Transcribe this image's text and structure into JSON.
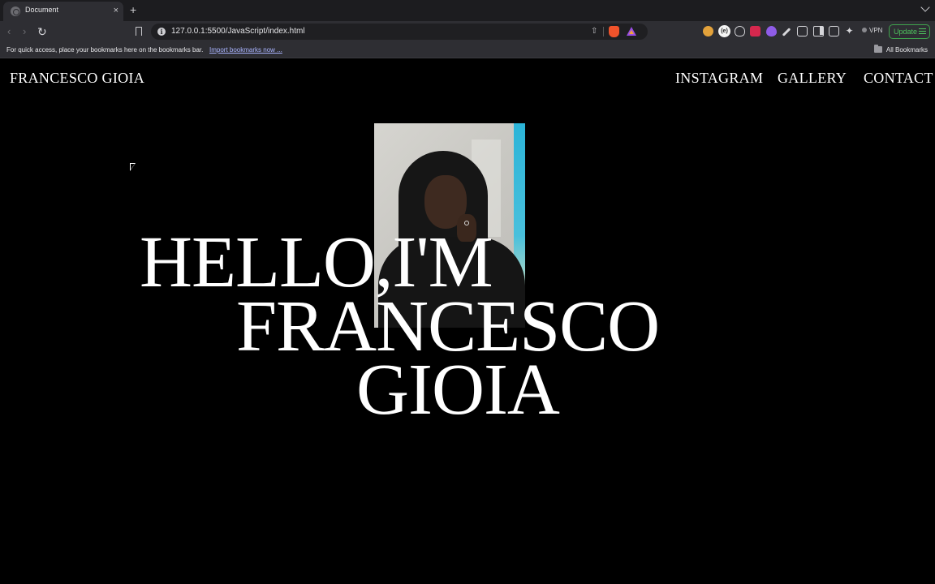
{
  "browser": {
    "tab_title": "Document",
    "tab_close": "×",
    "new_tab": "+",
    "url": "127.0.0.1:5500/JavaScript/index.html",
    "vpn_label": "VPN",
    "update_label": "Update",
    "bookmarks_hint": "For quick access, place your bookmarks here on the bookmarks bar.",
    "import_bookmarks": "Import bookmarks now ...",
    "all_bookmarks": "All Bookmarks"
  },
  "icons": {
    "back": "back-arrow-icon",
    "forward": "forward-arrow-icon",
    "reload": "reload-icon",
    "bookmark": "bookmark-icon",
    "site_info": "info-icon",
    "share": "share-icon",
    "brave_shields": "brave-shield-icon",
    "brave_rewards": "brave-rewards-icon",
    "extensions": "puzzle-icon",
    "sidebar": "sidebar-icon",
    "wallet": "wallet-icon",
    "leo": "sparkle-icon",
    "folder": "folder-icon"
  },
  "site": {
    "brand": "FRANCESCO GIOIA",
    "nav": [
      "INSTAGRAM",
      "GALLERY",
      "CONTACT"
    ],
    "hero_lines": [
      "HELLO,I'M",
      "FRANCESCO",
      "GIOIA"
    ]
  },
  "colors": {
    "page_background": "#000000",
    "text": "#ffffff",
    "update_accent": "#4ec25d",
    "link": "#a9b4ff"
  }
}
